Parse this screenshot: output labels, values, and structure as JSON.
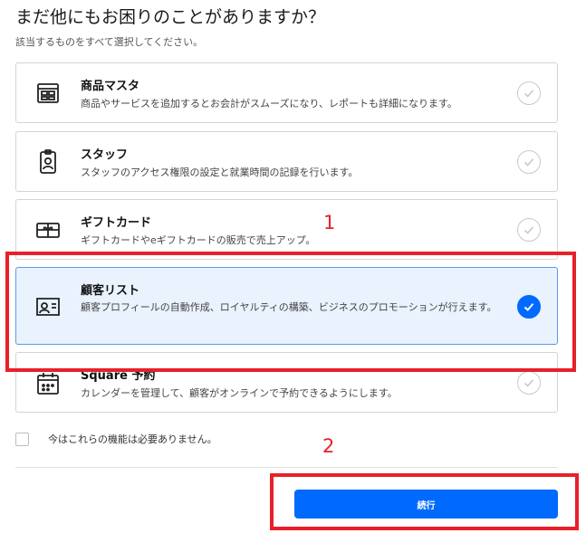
{
  "header": {
    "title": "まだ他にもお困りのことがありますか？",
    "subtitle": "該当するものをすべて選択してください。"
  },
  "options": [
    {
      "title": "商品マスタ",
      "description": "商品やサービスを追加するとお会計がスムーズになり、レポートも詳細になります。",
      "icon": "item-library-icon",
      "selected": false
    },
    {
      "title": "スタッフ",
      "description": "スタッフのアクセス権限の設定と就業時間の記録を行います。",
      "icon": "staff-badge-icon",
      "selected": false
    },
    {
      "title": "ギフトカード",
      "description": "ギフトカードやeギフトカードの販売で売上アップ。",
      "icon": "gift-card-icon",
      "selected": false
    },
    {
      "title": "顧客リスト",
      "description": "顧客プロフィールの自動作成、ロイヤルティの構築、ビジネスのプロモーションが行えます。",
      "icon": "customer-directory-icon",
      "selected": true
    },
    {
      "title": "Square 予約",
      "description": "カレンダーを管理して、顧客がオンラインで予約できるようにします。",
      "icon": "calendar-icon",
      "selected": false
    }
  ],
  "none_option": {
    "label": "今はこれらの機能は必要ありません。",
    "checked": false
  },
  "continue_button": {
    "label": "続行"
  },
  "annotations": {
    "marker_1": "1",
    "marker_2": "2"
  },
  "colors": {
    "accent": "#006aff",
    "selected_bg": "#e9f2fd",
    "annotation_red": "#e8202a"
  }
}
